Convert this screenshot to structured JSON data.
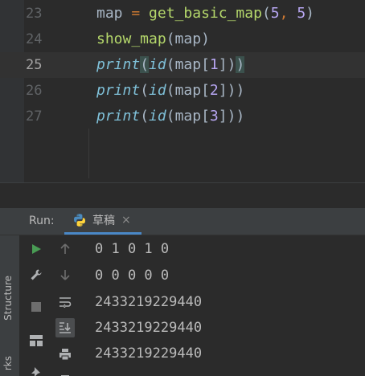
{
  "editor": {
    "lines": [
      {
        "num": "23",
        "tokens": [
          {
            "t": "map",
            "c": "tk-var"
          },
          {
            "t": " ",
            "c": "tk-var"
          },
          {
            "t": "=",
            "c": "tk-op"
          },
          {
            "t": " ",
            "c": "tk-var"
          },
          {
            "t": "get_basic_map",
            "c": "tk-fn"
          },
          {
            "t": "(",
            "c": "tk-punct"
          },
          {
            "t": "5",
            "c": "tk-num"
          },
          {
            "t": ", ",
            "c": "tk-op"
          },
          {
            "t": "5",
            "c": "tk-num"
          },
          {
            "t": ")",
            "c": "tk-punct"
          }
        ]
      },
      {
        "num": "24",
        "tokens": [
          {
            "t": "show_map",
            "c": "tk-fn"
          },
          {
            "t": "(",
            "c": "tk-punct"
          },
          {
            "t": "map",
            "c": "tk-var"
          },
          {
            "t": ")",
            "c": "tk-punct"
          }
        ]
      },
      {
        "num": "25",
        "current": true,
        "tokens": [
          {
            "t": "print",
            "c": "tk-builtin"
          },
          {
            "t": "(",
            "c": "tk-punct bracket-hl"
          },
          {
            "t": "id",
            "c": "tk-builtin"
          },
          {
            "t": "(",
            "c": "tk-punct"
          },
          {
            "t": "map",
            "c": "tk-var"
          },
          {
            "t": "[",
            "c": "tk-punct"
          },
          {
            "t": "1",
            "c": "tk-num"
          },
          {
            "t": "]",
            "c": "tk-punct"
          },
          {
            "t": ")",
            "c": "tk-punct"
          },
          {
            "t": ")",
            "c": "tk-punct bracket-hl"
          }
        ]
      },
      {
        "num": "26",
        "tokens": [
          {
            "t": "print",
            "c": "tk-builtin"
          },
          {
            "t": "(",
            "c": "tk-punct"
          },
          {
            "t": "id",
            "c": "tk-builtin"
          },
          {
            "t": "(",
            "c": "tk-punct"
          },
          {
            "t": "map",
            "c": "tk-var"
          },
          {
            "t": "[",
            "c": "tk-punct"
          },
          {
            "t": "2",
            "c": "tk-num"
          },
          {
            "t": "]",
            "c": "tk-punct"
          },
          {
            "t": ")",
            "c": "tk-punct"
          },
          {
            "t": ")",
            "c": "tk-punct"
          }
        ]
      },
      {
        "num": "27",
        "tokens": [
          {
            "t": "print",
            "c": "tk-builtin"
          },
          {
            "t": "(",
            "c": "tk-punct"
          },
          {
            "t": "id",
            "c": "tk-builtin"
          },
          {
            "t": "(",
            "c": "tk-punct"
          },
          {
            "t": "map",
            "c": "tk-var"
          },
          {
            "t": "[",
            "c": "tk-punct"
          },
          {
            "t": "3",
            "c": "tk-num"
          },
          {
            "t": "]",
            "c": "tk-punct"
          },
          {
            "t": ")",
            "c": "tk-punct"
          },
          {
            "t": ")",
            "c": "tk-punct"
          }
        ]
      }
    ]
  },
  "run": {
    "label": "Run:",
    "tab_title": "草稿",
    "tab_close": "×",
    "output": [
      "0 1 0 1 0",
      "0 0 0 0 0",
      "2433219229440",
      "2433219229440",
      "2433219229440"
    ]
  },
  "sidebar": {
    "structure": "Structure",
    "bookmarks_partial": "rks"
  },
  "icons": {
    "rerun": "play-icon",
    "up": "arrow-up-icon",
    "settings": "wrench-icon",
    "down": "arrow-down-icon",
    "stop": "stop-icon",
    "softwrap": "soft-wrap-icon",
    "layout": "layout-icon",
    "scroll_end": "scroll-to-end-icon",
    "pin": "pin-icon",
    "print": "print-icon"
  },
  "colors": {
    "accent_tab": "#4a88c7",
    "run_green": "#499c54",
    "background": "#2b2b2b"
  }
}
